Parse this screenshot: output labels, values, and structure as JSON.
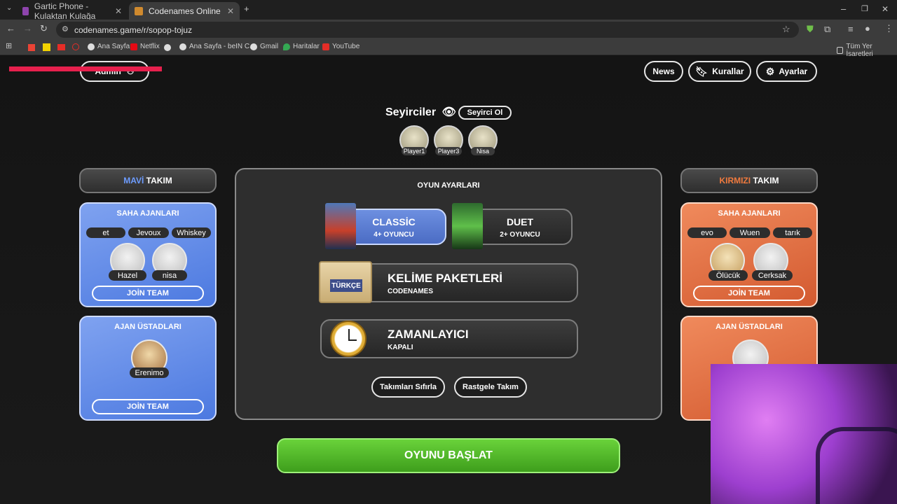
{
  "browser": {
    "tabs": [
      {
        "title": "Gartic Phone - Kulaktan Kulağa",
        "active": false
      },
      {
        "title": "Codenames Online",
        "active": true
      }
    ],
    "url": "codenames.game/r/sopop-tojuz",
    "bookmarks": [
      "Ana Sayfa",
      "Netflix",
      "Ana Sayfa - beIN C...",
      "Gmail",
      "Haritalar",
      "YouTube"
    ],
    "all_bookmarks": "Tüm Yer İşaretleri"
  },
  "header": {
    "admin_label": "Admin",
    "news": "News",
    "rules": "Kurallar",
    "settings": "Ayarlar"
  },
  "spectators": {
    "title": "Seyirciler",
    "button": "Seyirci Ol",
    "players": [
      "Player1",
      "Player3",
      "Nisa"
    ]
  },
  "blue_team": {
    "title_colored": "MAVİ",
    "title_rest": "TAKIM",
    "field_title": "SAHA AJANLARI",
    "field_players_top": [
      "et",
      "Jevoux",
      "Whiskey"
    ],
    "field_players_bottom": [
      "Hazel",
      "nisa"
    ],
    "join": "JOİN TEAM",
    "spymaster_title": "AJAN ÜSTADLARI",
    "spymasters": [
      "Erenimo"
    ],
    "join2": "JOİN TEAM"
  },
  "red_team": {
    "title_colored": "KIRMIZI",
    "title_rest": "TAKIM",
    "field_title": "SAHA AJANLARI",
    "field_players_top": [
      "evo",
      "Wuen",
      "tarık"
    ],
    "field_players_bottom": [
      "Ölücük",
      "Cerksak"
    ],
    "join": "JOİN TEAM",
    "spymaster_title": "AJAN ÜSTADLARI"
  },
  "game_settings": {
    "title": "OYUN AYARLARI",
    "modes": [
      {
        "name": "CLASSİC",
        "players": "4+ OYUNCU",
        "selected": true
      },
      {
        "name": "DUET",
        "players": "2+ OYUNCU",
        "selected": false
      }
    ],
    "word_pack": {
      "title": "KELİME PAKETLERİ",
      "sub": "CODENAMES",
      "badge": "TÜRKÇE"
    },
    "timer": {
      "title": "ZAMANLAYICI",
      "sub": "KAPALI"
    },
    "reset_teams": "Takımları Sıfırla",
    "random_teams": "Rastgele Takım"
  },
  "start_button": "OYUNU BAŞLAT",
  "colors": {
    "blue": "#5b84e6",
    "red": "#e06a3c",
    "green": "#4fba28"
  }
}
